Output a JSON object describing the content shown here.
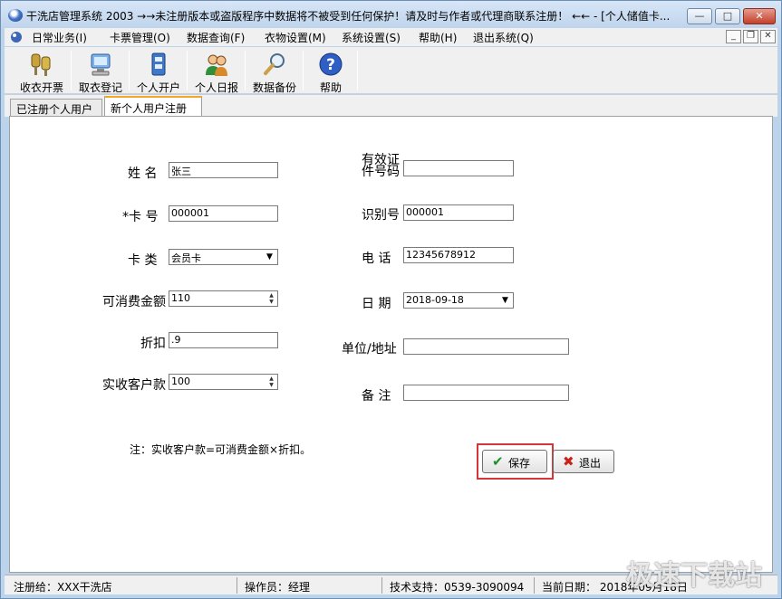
{
  "window": {
    "title": "干洗店管理系统 2003  →→未注册版本或盗版程序中数据将不被受到任何保护！请及时与作者或代理商联系注册！ ←← - [个人储值卡...",
    "min_label": "—",
    "max_label": "□",
    "close_label": "✕"
  },
  "menu": {
    "items": [
      "日常业务(I)",
      "卡票管理(O)",
      "数据查询(F)",
      "衣物设置(M)",
      "系统设置(S)",
      "帮助(H)",
      "退出系统(Q)"
    ],
    "mdi_min": "_",
    "mdi_restore": "❐",
    "mdi_close": "✕"
  },
  "toolbar": {
    "items": [
      {
        "label": "收衣开票",
        "icon": "keys-icon"
      },
      {
        "label": "取衣登记",
        "icon": "computer-icon"
      },
      {
        "label": "个人开户",
        "icon": "cabinet-icon"
      },
      {
        "label": "个人日报",
        "icon": "users-icon"
      },
      {
        "label": "数据备份",
        "icon": "magnifier-icon"
      },
      {
        "label": "帮助",
        "icon": "help-icon"
      }
    ]
  },
  "tabs": [
    {
      "label": "已注册个人用户",
      "active": false
    },
    {
      "label": "新个人用户注册",
      "active": true
    }
  ],
  "form": {
    "name_label": "姓  名",
    "name_value": "张三",
    "card_no_label": "*卡  号",
    "card_no_value": "000001",
    "card_type_label": "卡  类",
    "card_type_value": "会员卡",
    "spend_label": "可消费金额",
    "spend_value": "110",
    "discount_label": "折扣",
    "discount_value": ".9",
    "received_label": "实收客户款",
    "received_value": "100",
    "id_label_line1": "有效证",
    "id_label_line2": "件号码",
    "id_value": "",
    "idnum_label": "识别号",
    "idnum_value": "000001",
    "phone_label": "电  话",
    "phone_value": "12345678912",
    "date_label": "日  期",
    "date_value": "2018-09-18",
    "company_label": "单位/地址",
    "company_value": "",
    "remark_label": "备  注",
    "remark_value": "",
    "note": "注：实收客户款=可消费金额×折扣。",
    "save_label": "保存",
    "exit_label": "退出",
    "dropdown_arrow": "▼",
    "spin_up": "▲",
    "spin_down": "▼",
    "save_icon": "✔",
    "exit_icon": "✖"
  },
  "status": {
    "registered": "注册给：XXX干洗店",
    "operator": "操作员：经理",
    "support": "技术支持：0539-3090094",
    "date": "当前日期： 2018年09月18日"
  },
  "watermark": "极速下载站",
  "colors": {
    "highlight": "#d4363a",
    "active_tab_accent": "#f5a623",
    "titlebar": "#c8dcf2"
  }
}
